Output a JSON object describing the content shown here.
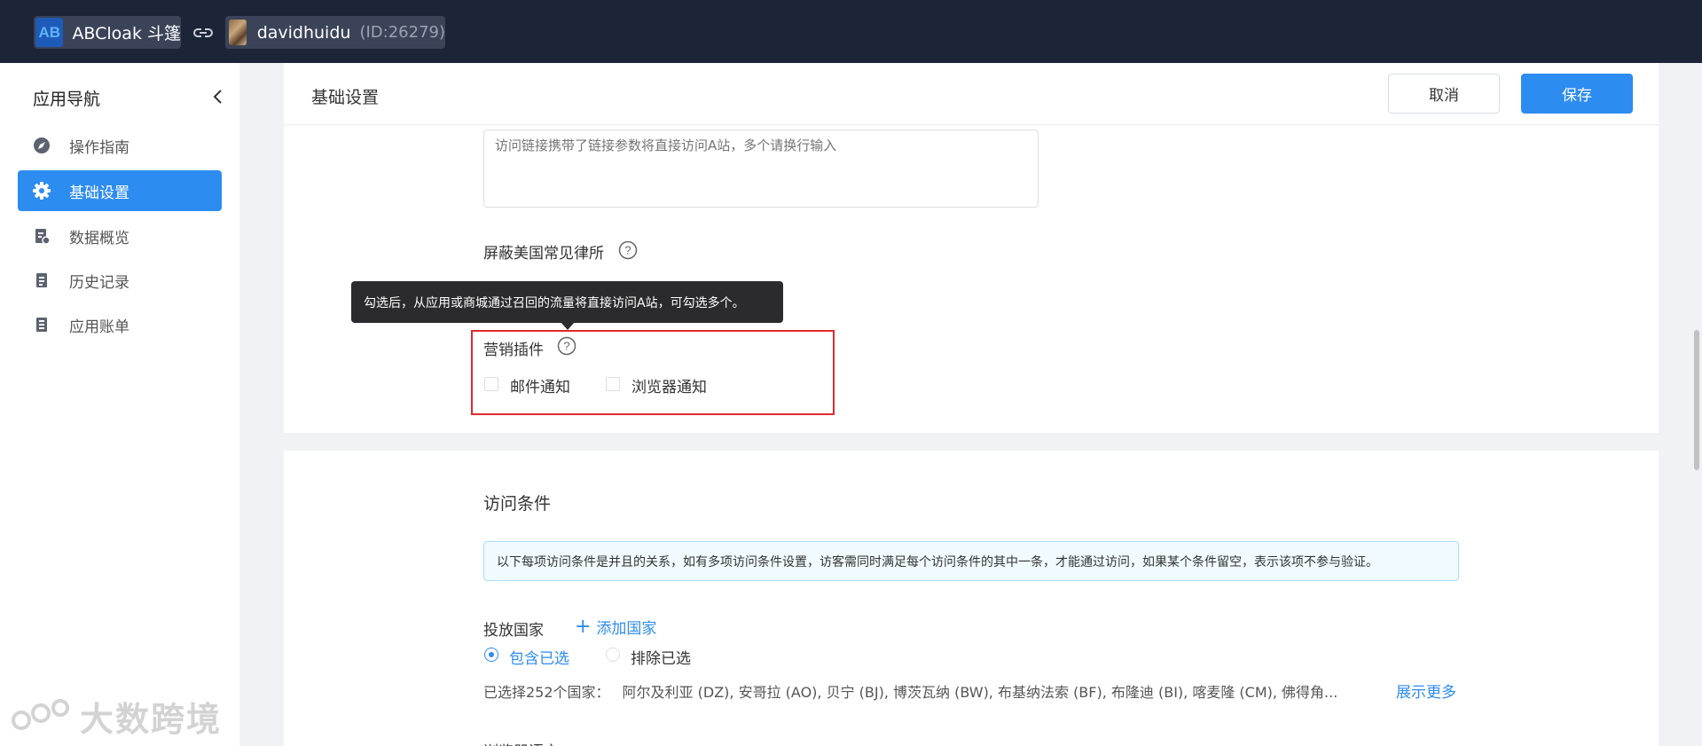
{
  "topbar": {
    "app_logo_text": "AB",
    "app_name": "ABCloak 斗篷",
    "user_name": "davidhuidu",
    "user_id": "(ID:26279)"
  },
  "sidebar": {
    "title": "应用导航",
    "items": [
      {
        "label": "操作指南",
        "icon": "compass-icon",
        "active": false
      },
      {
        "label": "基础设置",
        "icon": "gear-icon",
        "active": true
      },
      {
        "label": "数据概览",
        "icon": "data-overview-icon",
        "active": false
      },
      {
        "label": "历史记录",
        "icon": "history-icon",
        "active": false
      },
      {
        "label": "应用账单",
        "icon": "bill-icon",
        "active": false
      }
    ]
  },
  "header": {
    "title": "基础设置",
    "cancel_label": "取消",
    "save_label": "保存"
  },
  "settings": {
    "textarea_placeholder": "访问链接携带了链接参数将直接访问A站，多个请换行输入",
    "block_law_label": "屏蔽美国常见律所",
    "tooltip_text": "勾选后，从应用或商城通过召回的流量将直接访问A站，可勾选多个。",
    "marketing_label": "营销插件",
    "email_label": "邮件通知",
    "browser_label": "浏览器通知"
  },
  "access": {
    "title": "访问条件",
    "alert": "以下每项访问条件是并且的关系，如有多项访问条件设置，访客需同时满足每个访问条件的其中一条，才能通过访问，如果某个条件留空，表示该项不参与验证。",
    "country_label": "投放国家",
    "add_country": "添加国家",
    "include_label": "包含已选",
    "exclude_label": "排除已选",
    "selected_prefix": "已选择252个国家：",
    "selected_list": "阿尔及利亚 (DZ), 安哥拉 (AO), 贝宁 (BJ), 博茨瓦纳 (BW), 布基纳法索 (BF), 布隆迪 (BI), 喀麦隆 (CM), 佛得角...",
    "show_more": "展示更多",
    "next_label": "浏览器语言"
  },
  "watermark": "大数跨境",
  "colors": {
    "topbar_bg": "#1c2438",
    "primary": "#2d8cf0",
    "highlight_border": "#e0292f"
  }
}
